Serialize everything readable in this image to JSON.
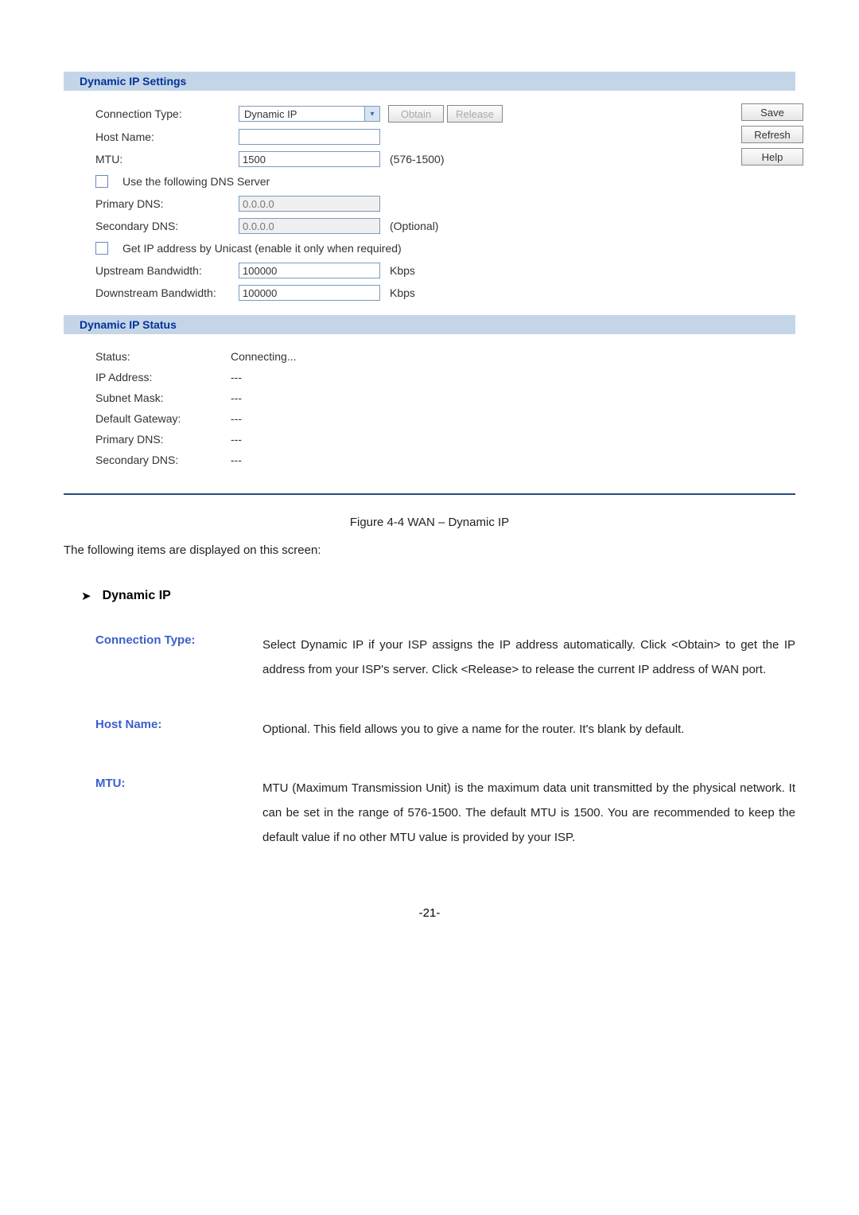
{
  "settings": {
    "header": "Dynamic IP Settings",
    "connectionType": {
      "label": "Connection Type:",
      "value": "Dynamic IP",
      "obtain": "Obtain",
      "release": "Release"
    },
    "hostName": {
      "label": "Host Name:",
      "value": ""
    },
    "mtu": {
      "label": "MTU:",
      "value": "1500",
      "range": "(576-1500)"
    },
    "useDns": "Use the following DNS Server",
    "primaryDns": {
      "label": "Primary DNS:",
      "placeholder": "0.0.0.0"
    },
    "secondaryDns": {
      "label": "Secondary DNS:",
      "placeholder": "0.0.0.0",
      "note": "(Optional)"
    },
    "unicast": "Get IP address by Unicast (enable it only when required)",
    "upstream": {
      "label": "Upstream Bandwidth:",
      "value": "100000",
      "unit": "Kbps"
    },
    "downstream": {
      "label": "Downstream Bandwidth:",
      "value": "100000",
      "unit": "Kbps"
    },
    "buttons": {
      "save": "Save",
      "refresh": "Refresh",
      "help": "Help"
    }
  },
  "status": {
    "header": "Dynamic IP Status",
    "rows": {
      "status": {
        "label": "Status:",
        "value": "Connecting..."
      },
      "ip": {
        "label": "IP Address:",
        "value": "---"
      },
      "subnet": {
        "label": "Subnet Mask:",
        "value": "---"
      },
      "gateway": {
        "label": "Default Gateway:",
        "value": "---"
      },
      "pdns": {
        "label": "Primary DNS:",
        "value": "---"
      },
      "sdns": {
        "label": "Secondary DNS:",
        "value": "---"
      }
    }
  },
  "caption": "Figure 4-4 WAN – Dynamic IP",
  "intro": "The following items are displayed on this screen:",
  "arrowTitle": "Dynamic IP",
  "defs": {
    "connType": {
      "term": "Connection Type:",
      "desc": "Select Dynamic IP if your ISP assigns the IP address automatically. Click <Obtain> to get the IP address from your ISP's server. Click <Release> to release the current IP address of WAN port."
    },
    "hostName": {
      "term": "Host Name:",
      "desc": "Optional. This field allows you to give a name for the router. It's blank by default."
    },
    "mtu": {
      "term": "MTU:",
      "desc": "MTU (Maximum Transmission Unit) is the maximum data unit transmitted by the physical network. It can be set in the range of 576-1500. The default MTU is 1500. You are recommended to keep the default value if no other MTU value is provided by your ISP."
    }
  },
  "pageNum": "-21-"
}
